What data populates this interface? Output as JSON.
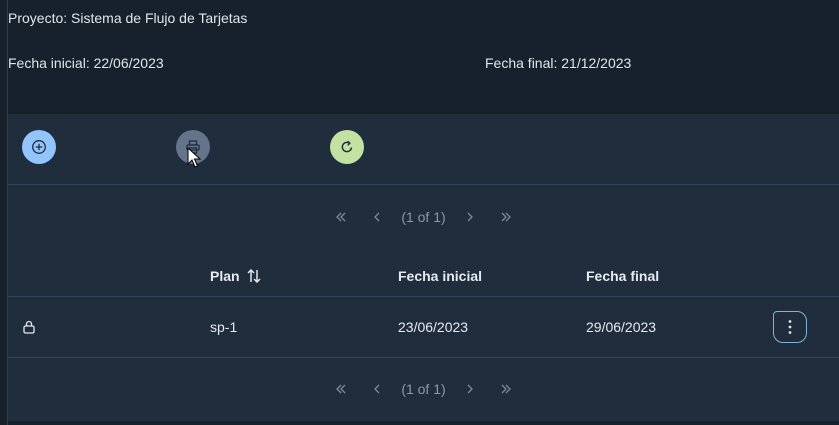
{
  "header": {
    "project": "Proyecto: Sistema de Flujo de Tarjetas",
    "start_date": "Fecha inicial: 22/06/2023",
    "end_date": "Fecha final: 21/12/2023"
  },
  "toolbar": {
    "buttons": [
      {
        "icon": "plus-circle-icon",
        "color": "#93c5fd"
      },
      {
        "icon": "print-icon",
        "color": "#64748b"
      },
      {
        "icon": "refresh-icon",
        "color": "#c3e1a0"
      }
    ]
  },
  "paginator": {
    "report": "(1 of 1)"
  },
  "table": {
    "columns": [
      "Plan",
      "Fecha inicial",
      "Fecha final"
    ],
    "rows": [
      {
        "locked": true,
        "plan": "sp-1",
        "start": "23/06/2023",
        "end": "29/06/2023"
      }
    ]
  }
}
